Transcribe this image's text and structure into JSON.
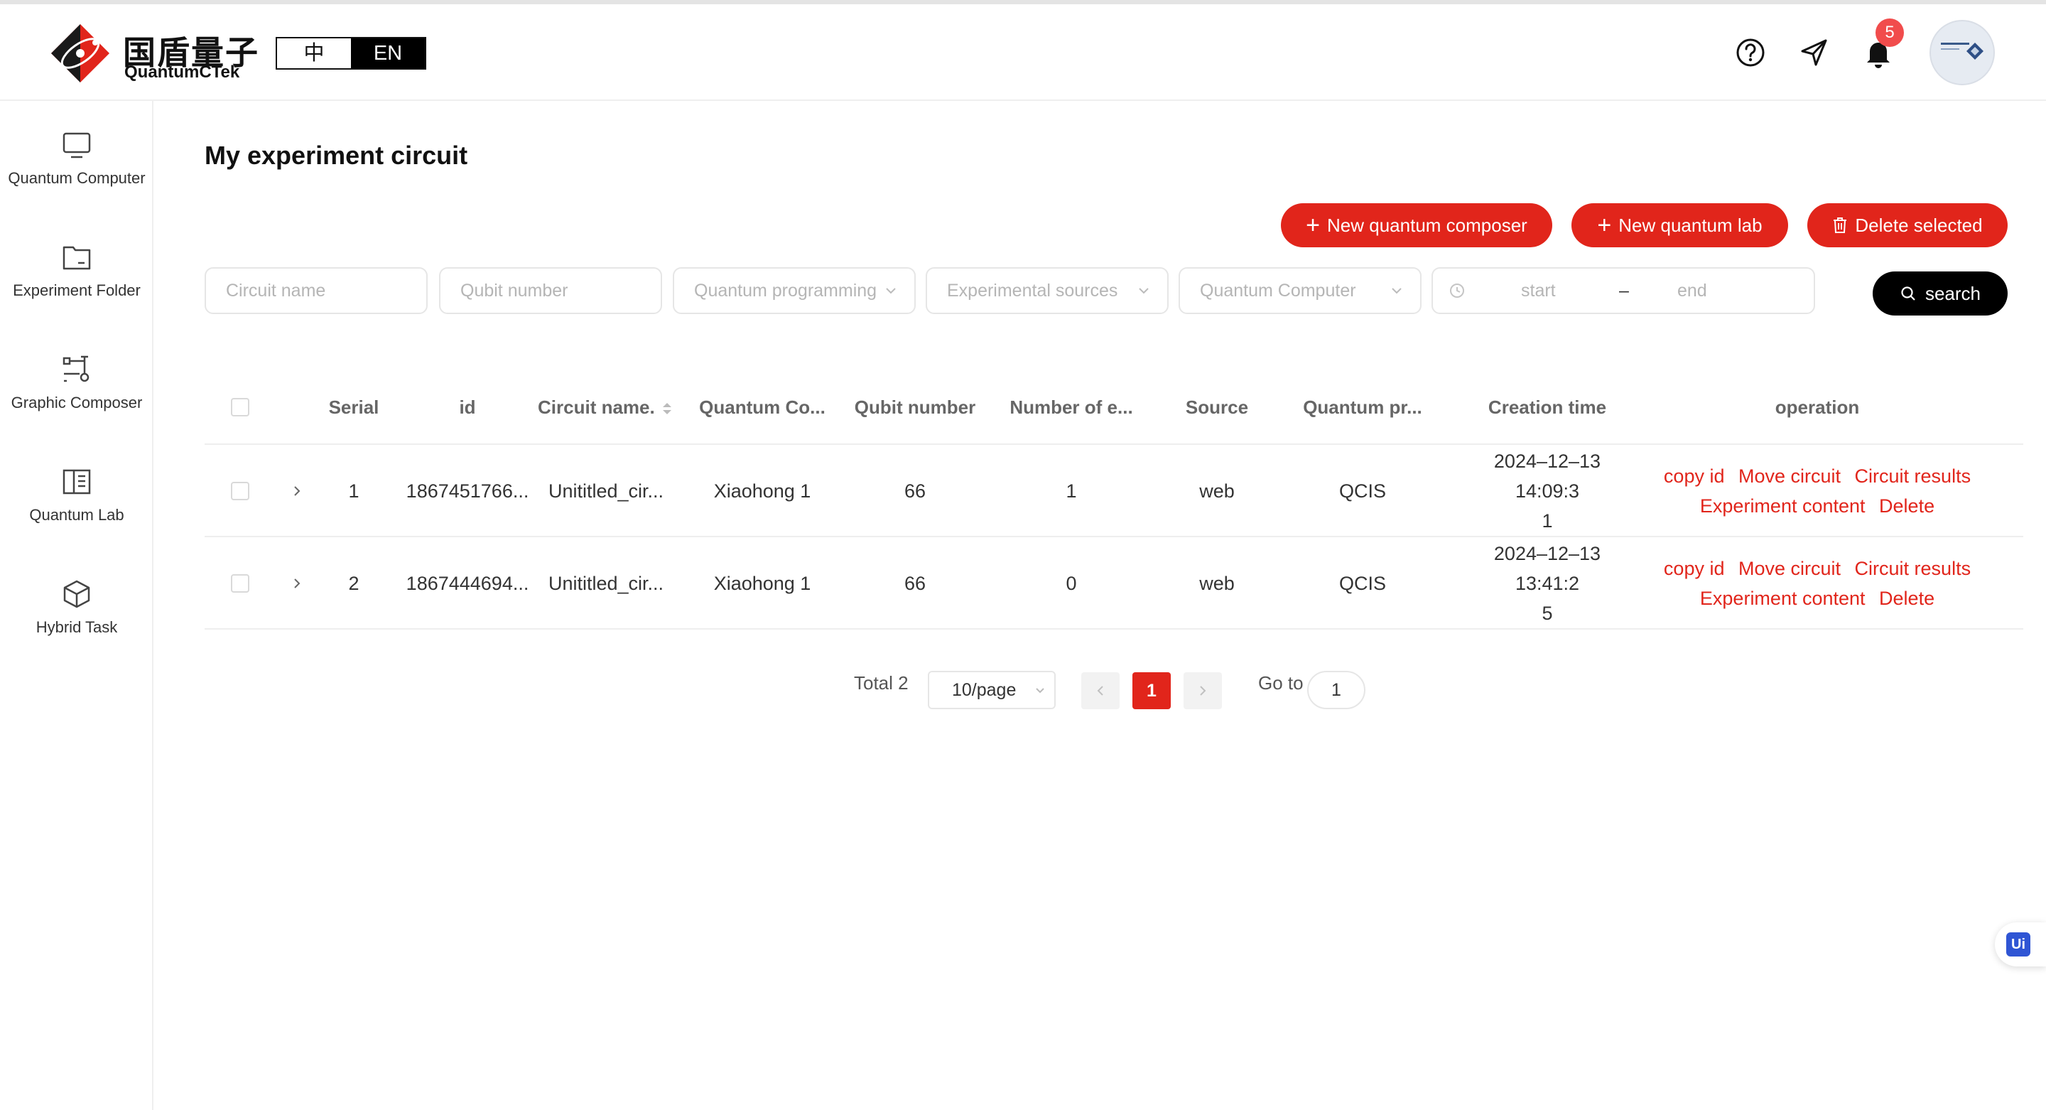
{
  "brand": {
    "name_cn": "国盾量子",
    "name_en": "QuantumCTek",
    "accent": "#e1251b"
  },
  "header": {
    "lang_zh": "中",
    "lang_en": "EN",
    "notification_count": "5",
    "icons": [
      "help-icon",
      "send-icon",
      "bell-icon",
      "avatar"
    ]
  },
  "sidebar": {
    "items": [
      {
        "label": "Quantum Computer",
        "icon": "monitor-icon"
      },
      {
        "label": "Experiment Folder",
        "icon": "folder-icon"
      },
      {
        "label": "Graphic Composer",
        "icon": "circuit-icon"
      },
      {
        "label": "Quantum Lab",
        "icon": "book-icon"
      },
      {
        "label": "Hybrid Task",
        "icon": "cube-icon"
      }
    ]
  },
  "main": {
    "title": "My experiment circuit",
    "buttons": {
      "new_composer": "New quantum composer",
      "new_lab": "New quantum lab",
      "delete_selected": "Delete selected",
      "search": "search"
    },
    "filters": {
      "circuit_name": "Circuit name",
      "qubit_number": "Qubit number",
      "programming": "Quantum programming",
      "sources": "Experimental sources",
      "computer": "Quantum Computer",
      "start": "start",
      "dash": "–",
      "end": "end"
    }
  },
  "table": {
    "headers": [
      "Serial",
      "id",
      "Circuit name.",
      "Quantum Co...",
      "Qubit number",
      "Number of e...",
      "Source",
      "Quantum pr...",
      "Creation time",
      "operation"
    ],
    "rows": [
      {
        "serial": "1",
        "id": "1867451766...",
        "name": "Unititled_cir...",
        "computer": "Xiaohong 1",
        "qubits": "66",
        "experiments": "1",
        "source": "web",
        "language": "QCIS",
        "time1": "2024–12–13 14:09:3",
        "time2": "1"
      },
      {
        "serial": "2",
        "id": "1867444694...",
        "name": "Unititled_cir...",
        "computer": "Xiaohong 1",
        "qubits": "66",
        "experiments": "0",
        "source": "web",
        "language": "QCIS",
        "time1": "2024–12–13 13:41:2",
        "time2": "5"
      }
    ],
    "operations": {
      "copy_id": "copy id",
      "move": "Move circuit",
      "results": "Circuit results",
      "content": "Experiment content",
      "delete": "Delete"
    }
  },
  "pagination": {
    "total": "Total 2",
    "page_size": "10/page",
    "current_page": "1",
    "goto_label": "Go to",
    "goto_value": "1"
  },
  "floating": {
    "label": "Ui"
  }
}
